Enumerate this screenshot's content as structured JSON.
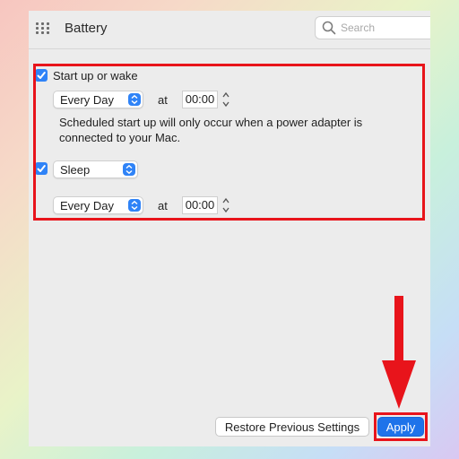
{
  "window": {
    "title": "Battery"
  },
  "search": {
    "placeholder": "Search"
  },
  "schedule": {
    "startup": {
      "label": "Start up or wake",
      "checked": true,
      "day": "Every Day",
      "at_label": "at",
      "time": "00:00",
      "note_line1": "Scheduled start up will only occur when a power adapter is",
      "note_line2": "connected to your Mac."
    },
    "sleep": {
      "checked": true,
      "action": "Sleep",
      "day": "Every Day",
      "at_label": "at",
      "time": "00:00"
    }
  },
  "buttons": {
    "restore": "Restore Previous Settings",
    "apply": "Apply"
  },
  "colors": {
    "accent": "#2f83f7",
    "annotation": "#e8141b",
    "apply_button": "#1e73ea"
  }
}
